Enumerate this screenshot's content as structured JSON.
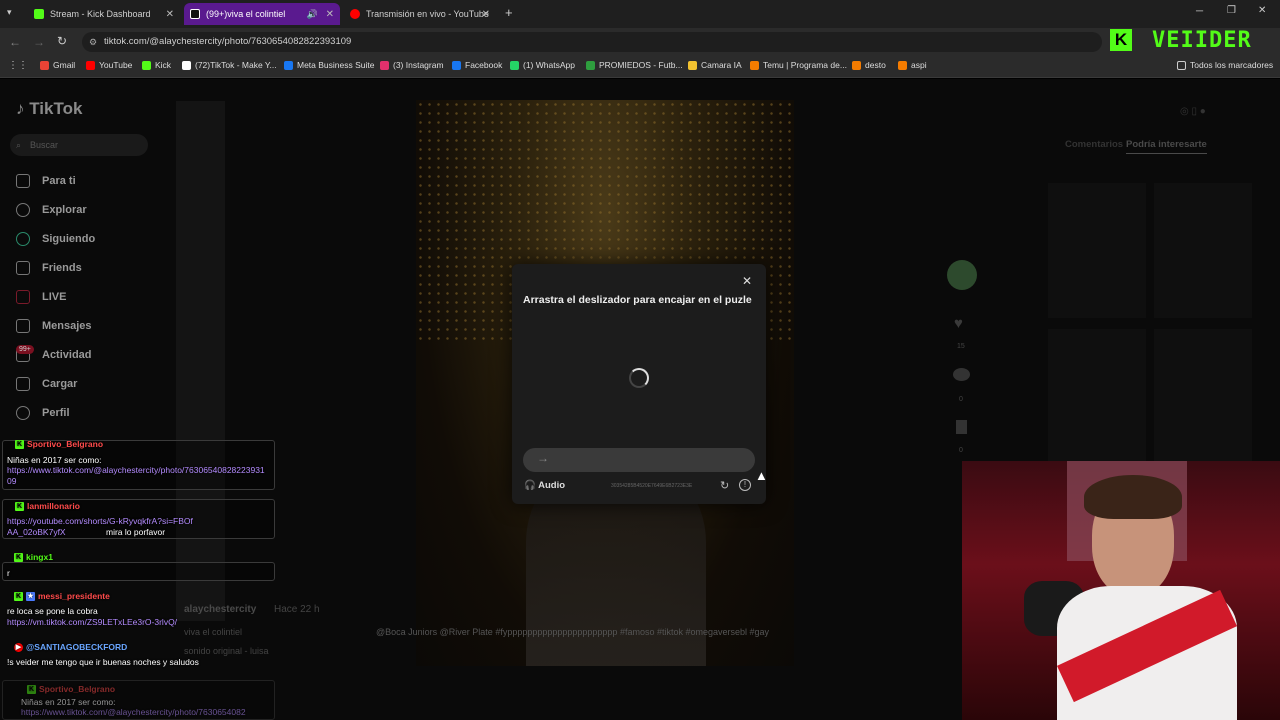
{
  "browser": {
    "tabs": [
      {
        "label": "Stream - Kick Dashboard",
        "color": "#53fc18"
      },
      {
        "label": "(99+)viva el colintiel",
        "color": "#ffffff"
      },
      {
        "label": "Transmisión en vivo - YouTube",
        "color": "#ff0000"
      }
    ],
    "url": "tiktok.com/@alaychestercity/photo/7630654082822393109",
    "bookmarks": [
      {
        "label": "Gmail",
        "color": "#ea4335"
      },
      {
        "label": "YouTube",
        "color": "#ff0000"
      },
      {
        "label": "Kick",
        "color": "#53fc18"
      },
      {
        "label": "(72)TikTok - Make Y...",
        "color": "#ffffff"
      },
      {
        "label": "Meta Business Suite",
        "color": "#1877f2"
      },
      {
        "label": "(3) Instagram",
        "color": "#e1306c"
      },
      {
        "label": "Facebook",
        "color": "#1877f2"
      },
      {
        "label": "(1) WhatsApp",
        "color": "#25d366"
      },
      {
        "label": "PROMIEDOS - Futb...",
        "color": "#2e9e3e"
      },
      {
        "label": "Camara IA",
        "color": "#f2c230"
      },
      {
        "label": "Temu | Programa de...",
        "color": "#f57c00"
      },
      {
        "label": "desto",
        "color": "#f57c00"
      },
      {
        "label": "aspi",
        "color": "#f57c00"
      }
    ],
    "all_bookmarks": "Todos los marcadores"
  },
  "tiktok": {
    "logo": "TikTok",
    "search_placeholder": "Buscar",
    "nav": [
      "Para ti",
      "Explorar",
      "Siguiendo",
      "Friends",
      "LIVE",
      "Mensajes",
      "Actividad",
      "Cargar",
      "Perfil"
    ],
    "activity_badge": "99+",
    "tabs": {
      "comments": "Comentarios",
      "related": "Podría interesarte"
    },
    "counts": {
      "likes": "15",
      "comments": "0",
      "saves": "0",
      "shares": "0"
    },
    "post_author": "alaychestercity",
    "post_time": "Hace 22 h",
    "post_caption": "viva el colintiel",
    "post_tags": "@Boca Juniors @River Plate #fypppppppppppppppppppppp #famoso #tiktok #omegaversebl #gay",
    "post_sound": "sonido original - luisa"
  },
  "captcha": {
    "title": "Arrastra el deslizador para encajar en el puzle",
    "audio": "Audio",
    "code": "30354285B4520E7649E6B2723E3E"
  },
  "stream": {
    "brand": "VEIIDER",
    "chat": [
      {
        "user": "Sportivo_Belgrano",
        "text": "Niñas en 2017 ser como:",
        "link": "https://www.tiktok.com/@alaychestercity/photo/7630654082822393109",
        "color": "#ff4b4b"
      },
      {
        "user": "lanmillonario",
        "text": "mira lo porfavor",
        "link": "https://youtube.com/shorts/G-kRyvqkfrA?si=FBOfAA_02oBK7yfX",
        "color": "#ff4b4b"
      },
      {
        "user": "kingx1",
        "text": "r",
        "link": "",
        "color": "#53fc18"
      },
      {
        "user": "messi_presidente",
        "text": "re loca se pone la cobra",
        "link": "https://vm.tiktok.com/ZS9LETxLEe3rO-3rlvQ/",
        "color": "#ff4b4b"
      },
      {
        "user": "@SANTIAGOBECKFORD",
        "text": "!s veider me tengo que ir buenas noches y saludos",
        "link": "",
        "color": "#6aa6ff"
      },
      {
        "user": "Sportivo_Belgrano",
        "text": "Niñas en 2017 ser como:",
        "link": "https://www.tiktok.com/@alaychestercity/photo/7630654082",
        "color": "#ff4b4b"
      }
    ]
  }
}
